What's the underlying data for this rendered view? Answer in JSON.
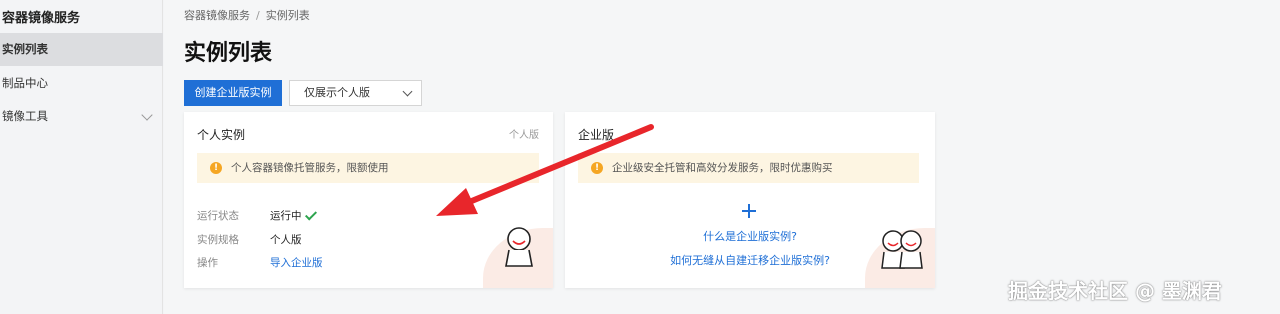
{
  "sidebar": {
    "title": "容器镜像服务",
    "items": [
      {
        "label": "实例列表",
        "active": true
      },
      {
        "label": "制品中心",
        "active": false
      },
      {
        "label": "镜像工具",
        "active": false,
        "expandable": true
      }
    ]
  },
  "breadcrumb": {
    "root": "容器镜像服务",
    "separator": "/",
    "current": "实例列表"
  },
  "page_title": "实例列表",
  "toolbar": {
    "create_label": "创建企业版实例",
    "filter_value": "仅展示个人版"
  },
  "personal_card": {
    "title": "个人实例",
    "tag": "个人版",
    "notice": "个人容器镜像托管服务，限额使用",
    "rows": [
      {
        "label": "运行状态",
        "value": "运行中"
      },
      {
        "label": "实例规格",
        "value": "个人版"
      },
      {
        "label": "操作",
        "value": "导入企业版"
      }
    ]
  },
  "enterprise_card": {
    "title": "企业版",
    "notice": "企业级安全托管和高效分发服务，限时优惠购买",
    "link_what": "什么是企业版实例?",
    "link_migrate": "如何无缝从自建迁移企业版实例?"
  },
  "watermark": "掘金技术社区 @ 墨渊君",
  "colors": {
    "primary": "#1f6fd6",
    "warning": "#f5a623",
    "success": "#2da44e",
    "arrow": "#e8262b"
  }
}
